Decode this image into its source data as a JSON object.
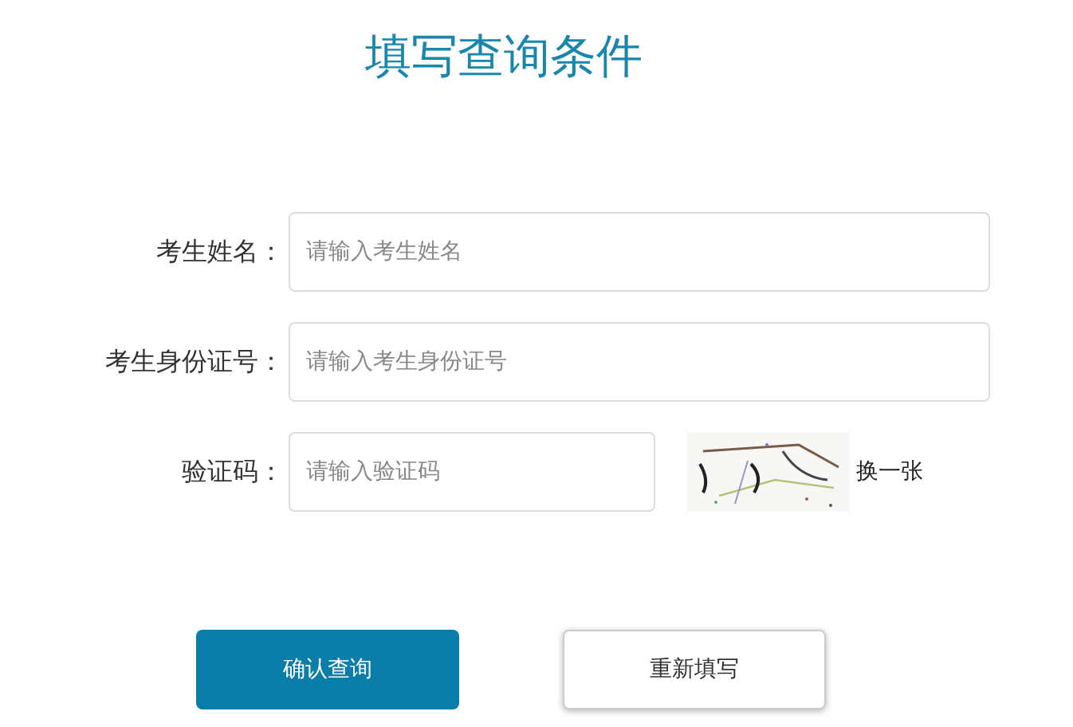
{
  "title": "填写查询条件",
  "fields": [
    {
      "label": "考生姓名：",
      "placeholder": "请输入考生姓名",
      "kind": "text"
    },
    {
      "label": "考生身份证号：",
      "placeholder": "请输入考生身份证号",
      "kind": "text"
    },
    {
      "label": "验证码：",
      "placeholder": "请输入验证码",
      "kind": "captcha",
      "refresh": "换一张"
    }
  ],
  "buttons": [
    {
      "label": "确认查询",
      "kind": "primary"
    },
    {
      "label": "重新填写",
      "kind": "secondary"
    }
  ]
}
